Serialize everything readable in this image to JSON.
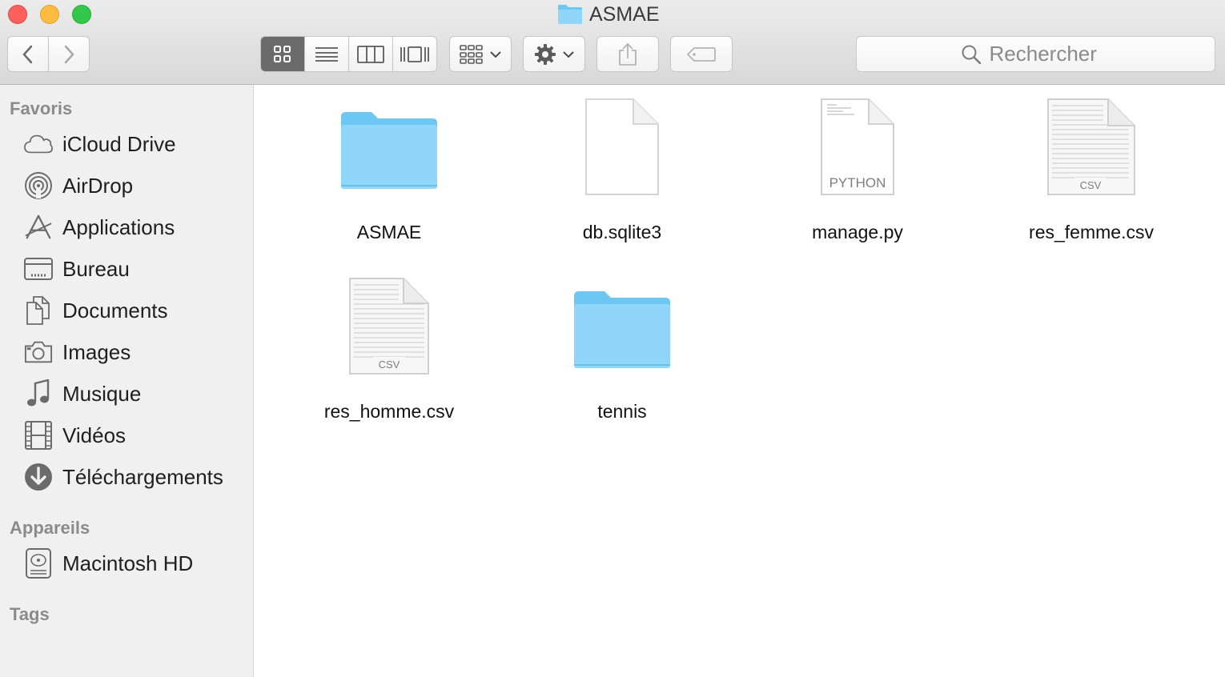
{
  "window": {
    "title": "ASMAE"
  },
  "toolbar": {
    "back_icon": "chevron-left-icon",
    "forward_icon": "chevron-right-icon",
    "view_modes": [
      "icon-view",
      "list-view",
      "column-view",
      "cover-flow-view"
    ],
    "active_view": "icon-view",
    "arrange_icon": "arrange-grid-icon",
    "action_icon": "gear-icon",
    "share_icon": "share-icon",
    "tag_icon": "tag-icon"
  },
  "search": {
    "placeholder": "Rechercher"
  },
  "sidebar": {
    "favorites_title": "Favoris",
    "favorites": [
      {
        "label": "iCloud Drive",
        "icon": "cloud-icon"
      },
      {
        "label": "AirDrop",
        "icon": "airdrop-icon"
      },
      {
        "label": "Applications",
        "icon": "applications-icon"
      },
      {
        "label": "Bureau",
        "icon": "desktop-icon"
      },
      {
        "label": "Documents",
        "icon": "documents-icon"
      },
      {
        "label": "Images",
        "icon": "camera-icon"
      },
      {
        "label": "Musique",
        "icon": "music-note-icon"
      },
      {
        "label": "Vidéos",
        "icon": "film-icon"
      },
      {
        "label": "Téléchargements",
        "icon": "download-icon"
      }
    ],
    "devices_title": "Appareils",
    "devices": [
      {
        "label": "Macintosh HD",
        "icon": "hard-drive-icon"
      }
    ],
    "tags_title": "Tags"
  },
  "files": [
    {
      "name": "ASMAE",
      "kind": "folder"
    },
    {
      "name": "db.sqlite3",
      "kind": "blank"
    },
    {
      "name": "manage.py",
      "kind": "python",
      "badge": "PYTHON"
    },
    {
      "name": "res_femme.csv",
      "kind": "csv",
      "badge": "CSV"
    },
    {
      "name": "res_homme.csv",
      "kind": "csv",
      "badge": "CSV"
    },
    {
      "name": "tennis",
      "kind": "folder"
    }
  ],
  "colors": {
    "folder_blue": "#7fd0f7",
    "close": "#fc605c",
    "minimize": "#fdbc40",
    "maximize": "#34c84a"
  }
}
